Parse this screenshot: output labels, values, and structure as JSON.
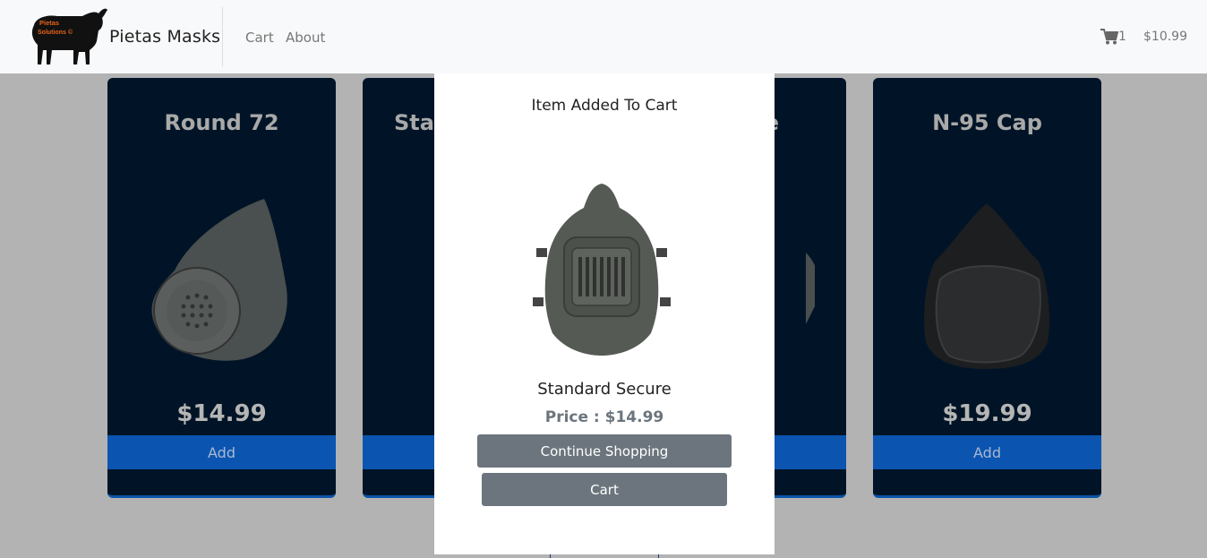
{
  "navbar": {
    "logo_text": "Pietas Solutions ©",
    "brand": "Pietas Masks",
    "links": [
      {
        "label": "Cart"
      },
      {
        "label": "About"
      }
    ],
    "cart_count": "1",
    "cart_total": "$10.99"
  },
  "products": [
    {
      "title": "Round 72",
      "price": "$14.99",
      "add_label": "Add"
    },
    {
      "title": "Star",
      "price": "",
      "add_label": ""
    },
    {
      "title": "e",
      "price": "",
      "add_label": ""
    },
    {
      "title": "N-95 Cap",
      "price": "$19.99",
      "add_label": "Add"
    }
  ],
  "modal": {
    "title": "Item Added To Cart",
    "product_name": "Standard Secure",
    "price_text": "Price : $14.99",
    "continue_label": "Continue Shopping",
    "cart_label": "Cart"
  }
}
